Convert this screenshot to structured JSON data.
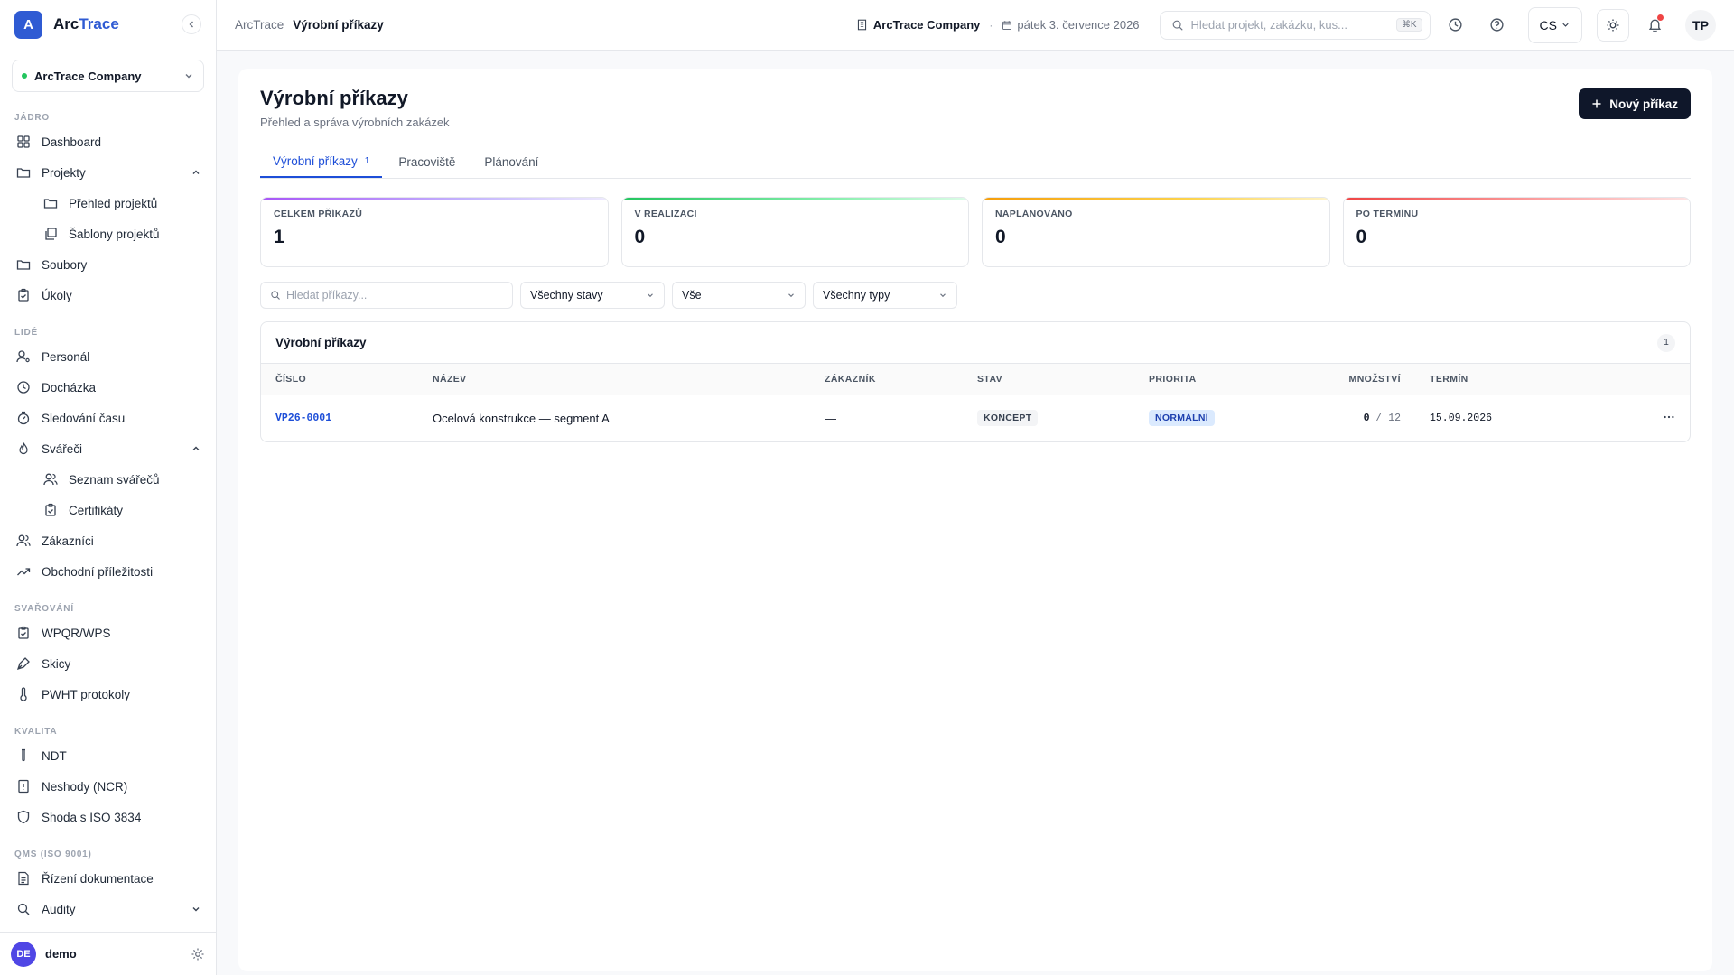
{
  "brand": {
    "initial": "A",
    "name_part1": "Arc",
    "name_part2": "Trace"
  },
  "company_selector": {
    "name": "ArcTrace Company"
  },
  "sidebar": {
    "sections": [
      {
        "label": "JÁDRO"
      },
      {
        "label": "LIDÉ"
      },
      {
        "label": "SVAŘOVÁNÍ"
      },
      {
        "label": "KVALITA"
      },
      {
        "label": "QMS (ISO 9001)"
      }
    ],
    "items": {
      "dashboard": "Dashboard",
      "projekty": "Projekty",
      "prehled_projektu": "Přehled projektů",
      "sablony_projektu": "Šablony projektů",
      "soubory": "Soubory",
      "ukoly": "Úkoly",
      "personal": "Personál",
      "dochazka": "Docházka",
      "sledovani_casu": "Sledování času",
      "svareci": "Svářeči",
      "seznam_svarecu": "Seznam svářečů",
      "certifikaty": "Certifikáty",
      "zakaznici": "Zákazníci",
      "obchodni_prilezitosti": "Obchodní příležitosti",
      "wpqr_wps": "WPQR/WPS",
      "skicy": "Skicy",
      "pwht_protokoly": "PWHT protokoly",
      "ndt": "NDT",
      "neshody": "Neshody (NCR)",
      "shoda_iso": "Shoda s ISO 3834",
      "rizeni_dokumentace": "Řízení dokumentace",
      "audity": "Audity"
    },
    "user": {
      "initials": "DE",
      "name": "demo"
    }
  },
  "topbar": {
    "breadcrumb_root": "ArcTrace",
    "breadcrumb_current": "Výrobní příkazy",
    "company": "ArcTrace Company",
    "separator": "·",
    "date": "pátek 3. července 2026",
    "search_placeholder": "Hledat projekt, zakázku, kus...",
    "search_shortcut": "⌘K",
    "language": "CS",
    "avatar": "TP"
  },
  "page": {
    "title": "Výrobní příkazy",
    "subtitle": "Přehled a správa výrobních zakázek",
    "new_button": "Nový příkaz",
    "tabs": [
      {
        "label": "Výrobní příkazy",
        "count": "1"
      },
      {
        "label": "Pracoviště"
      },
      {
        "label": "Plánování"
      }
    ],
    "stats": [
      {
        "label": "CELKEM PŘÍKAZŮ",
        "value": "1",
        "color": "#a855f7"
      },
      {
        "label": "V REALIZACI",
        "value": "0",
        "color": "#22c55e"
      },
      {
        "label": "NAPLÁNOVÁNO",
        "value": "0",
        "color": "#f59e0b"
      },
      {
        "label": "PO TERMÍNU",
        "value": "0",
        "color": "#ef4444"
      }
    ],
    "filters": {
      "search_placeholder": "Hledat příkazy...",
      "status": "Všechny stavy",
      "priority": "Vše",
      "type": "Všechny typy"
    },
    "table": {
      "title": "Výrobní příkazy",
      "count": "1",
      "columns": {
        "cislo": "ČÍSLO",
        "nazev": "NÁZEV",
        "zakaznik": "ZÁKAZNÍK",
        "stav": "STAV",
        "priorita": "PRIORITA",
        "mnozstvi": "MNOŽSTVÍ",
        "termin": "TERMÍN"
      },
      "rows": [
        {
          "cislo": "VP26-0001",
          "nazev": "Ocelová konstrukce — segment A",
          "zakaznik": "—",
          "stav": "KONCEPT",
          "priorita": "NORMÁLNÍ",
          "qty_done": "0",
          "qty_total": "/ 12",
          "termin": "15.09.2026"
        }
      ]
    }
  }
}
